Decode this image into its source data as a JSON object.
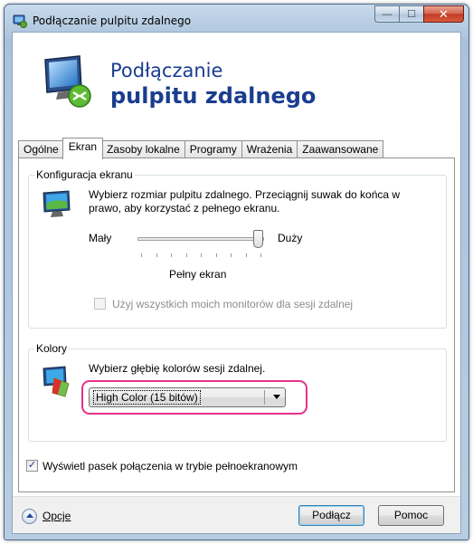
{
  "window": {
    "title": "Podłączanie pulpitu zdalnego",
    "minimize_glyph": "—",
    "maximize_glyph": "☐",
    "close_glyph": "✕"
  },
  "header": {
    "line1": "Podłączanie",
    "line2": "pulpitu zdalnego"
  },
  "tabs": [
    {
      "label": "Ogólne"
    },
    {
      "label": "Ekran",
      "active": true
    },
    {
      "label": "Zasoby lokalne"
    },
    {
      "label": "Programy"
    },
    {
      "label": "Wrażenia"
    },
    {
      "label": "Zaawansowane"
    }
  ],
  "display_config": {
    "group_label": "Konfiguracja ekranu",
    "description": "Wybierz rozmiar pulpitu zdalnego. Przeciągnij suwak do końca w prawo, aby korzystać z pełnego ekranu.",
    "slider_min_label": "Mały",
    "slider_max_label": "Duży",
    "slider_value_text": "Pełny ekran",
    "slider_position": 1.0,
    "tick_count": 9,
    "multimon_checkbox": {
      "label": "Użyj wszystkich moich monitorów dla sesji zdalnej",
      "checked": false,
      "enabled": false
    }
  },
  "colors": {
    "group_label": "Kolory",
    "description": "Wybierz głębię kolorów sesji zdalnej.",
    "selected_value": "High Color (15 bitów)",
    "highlight_color": "#e8308a"
  },
  "connection_bar": {
    "label": "Wyświetl pasek połączenia w trybie pełnoekranowym",
    "checked": true,
    "check_glyph": "✓"
  },
  "footer": {
    "options_label": "Opcje",
    "connect_label": "Podłącz",
    "help_label": "Pomoc"
  }
}
